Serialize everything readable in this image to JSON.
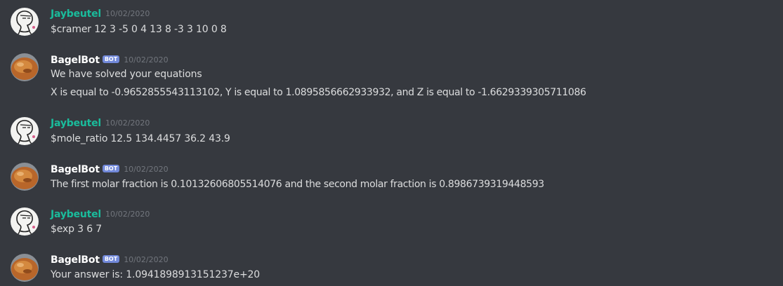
{
  "messages": [
    {
      "author": "Jaybeutel",
      "is_bot": false,
      "timestamp": "10/02/2020",
      "lines": [
        "$cramer 12 3 -5 0 4 13 8 -3 3 10 0 8"
      ]
    },
    {
      "author": "BagelBot",
      "is_bot": true,
      "bot_tag": "BOT",
      "timestamp": "10/02/2020",
      "lines": [
        "We have solved your equations",
        "X is equal to -0.9652855543113102, Y is equal to 1.0895856662933932, and Z is equal to -1.6629339305711086"
      ]
    },
    {
      "author": "Jaybeutel",
      "is_bot": false,
      "timestamp": "10/02/2020",
      "lines": [
        "$mole_ratio 12.5 134.4457 36.2 43.9"
      ]
    },
    {
      "author": "BagelBot",
      "is_bot": true,
      "bot_tag": "BOT",
      "timestamp": "10/02/2020",
      "lines": [
        "The first molar fraction is 0.10132606805514076 and the second molar fraction is 0.8986739319448593"
      ]
    },
    {
      "author": "Jaybeutel",
      "is_bot": false,
      "timestamp": "10/02/2020",
      "lines": [
        "$exp 3 6 7"
      ]
    },
    {
      "author": "BagelBot",
      "is_bot": true,
      "bot_tag": "BOT",
      "timestamp": "10/02/2020",
      "lines": [
        "Your answer is: 1.0941898913151237e+20"
      ]
    }
  ],
  "colors": {
    "background": "#36393f",
    "user_name": "#1abc9c",
    "bot_name": "#ffffff",
    "bot_tag": "#7289da",
    "message_text": "#dcddde",
    "timestamp": "#72767d"
  },
  "icons": {
    "user_avatar": "sketch-portrait-avatar-icon",
    "bot_avatar": "bagel-avatar-icon"
  }
}
